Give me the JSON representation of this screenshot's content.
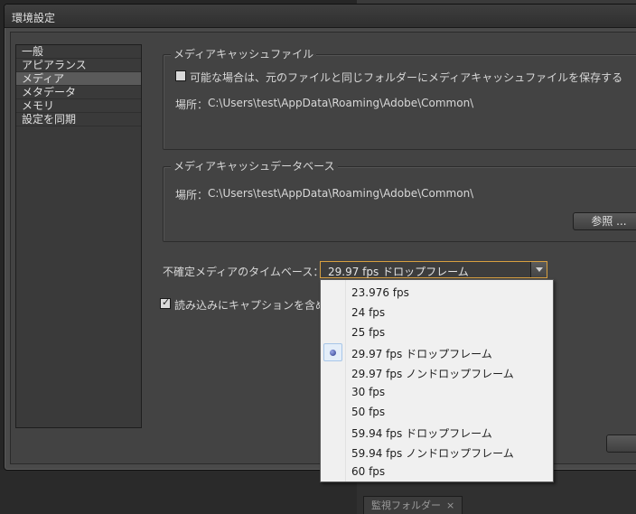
{
  "window": {
    "title": "環境設定"
  },
  "background": {
    "panel_tab_label": "監視フォルダー",
    "panel_tab_close": "×"
  },
  "sidebar": {
    "items": [
      {
        "label": "一般"
      },
      {
        "label": "アピアランス"
      },
      {
        "label": "メディア",
        "selected": true
      },
      {
        "label": "メタデータ"
      },
      {
        "label": "メモリ"
      },
      {
        "label": "設定を同期"
      }
    ]
  },
  "media_cache_files": {
    "legend": "メディアキャッシュファイル",
    "save_next_to_originals_label": "可能な場合は、元のファイルと同じフォルダーにメディアキャッシュファイルを保存する",
    "save_next_to_originals_checked": false,
    "location_label": "場所：",
    "location_path": "C:\\Users\\test\\AppData\\Roaming\\Adobe\\Common\\"
  },
  "media_cache_database": {
    "legend": "メディアキャッシュデータベース",
    "location_label": "場所：",
    "location_path": "C:\\Users\\test\\AppData\\Roaming\\Adobe\\Common\\",
    "browse_label": "参照 ..."
  },
  "timebase": {
    "label": "不確定メディアのタイムベース：",
    "selected": "29.97 fps ドロップフレーム",
    "options": [
      "23.976 fps",
      "24 fps",
      "25 fps",
      "29.97 fps ドロップフレーム",
      "29.97 fps ノンドロップフレーム",
      "30 fps",
      "50 fps",
      "59.94 fps ドロップフレーム",
      "59.94 fps ノンドロップフレーム",
      "60 fps"
    ],
    "selected_index": 3
  },
  "captions": {
    "label": "読み込みにキャプションを含める",
    "checked": true
  },
  "colors": {
    "accent_focus": "#d8a040",
    "dialog_bg": "#434343"
  }
}
